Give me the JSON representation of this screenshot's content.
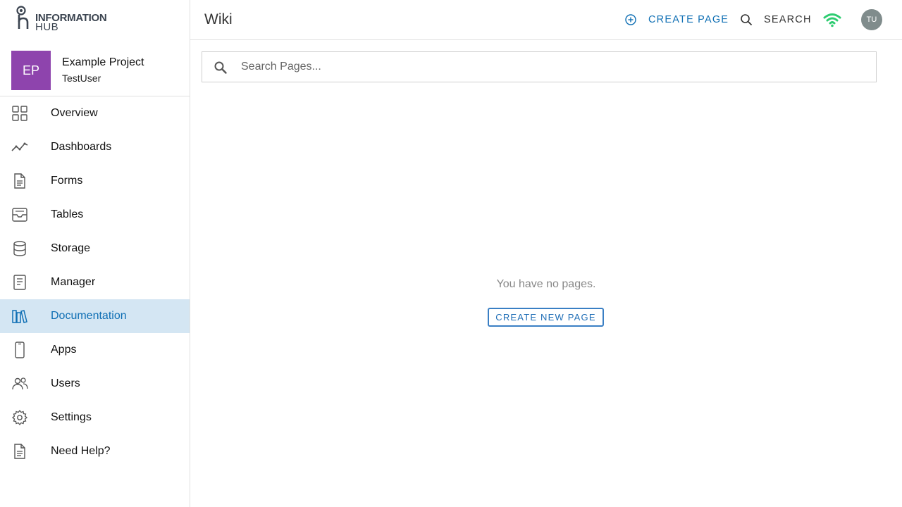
{
  "app": {
    "logo_line1": "INFORMATION",
    "logo_line2": "HUB"
  },
  "project": {
    "initials": "EP",
    "name": "Example Project",
    "user": "TestUser",
    "avatar_color": "#8e44ad"
  },
  "sidebar": {
    "items": [
      {
        "label": "Overview",
        "icon": "grid-icon"
      },
      {
        "label": "Dashboards",
        "icon": "trend-line-icon"
      },
      {
        "label": "Forms",
        "icon": "document-icon"
      },
      {
        "label": "Tables",
        "icon": "inbox-tray-icon"
      },
      {
        "label": "Storage",
        "icon": "database-icon"
      },
      {
        "label": "Manager",
        "icon": "notepad-icon"
      },
      {
        "label": "Documentation",
        "icon": "books-icon",
        "active": true
      },
      {
        "label": "Apps",
        "icon": "phone-icon"
      },
      {
        "label": "Users",
        "icon": "users-icon"
      },
      {
        "label": "Settings",
        "icon": "gear-icon"
      },
      {
        "label": "Need Help?",
        "icon": "help-document-icon"
      }
    ],
    "active_color": "#0f6fb4",
    "active_bg": "#d4e6f3"
  },
  "header": {
    "title": "Wiki",
    "create_page_label": "CREATE PAGE",
    "search_label": "SEARCH",
    "user_initials": "TU",
    "wifi_color": "#2ecc71"
  },
  "search": {
    "placeholder": "Search Pages...",
    "value": ""
  },
  "main": {
    "empty_message": "You have no pages.",
    "create_new_label": "CREATE NEW PAGE"
  }
}
